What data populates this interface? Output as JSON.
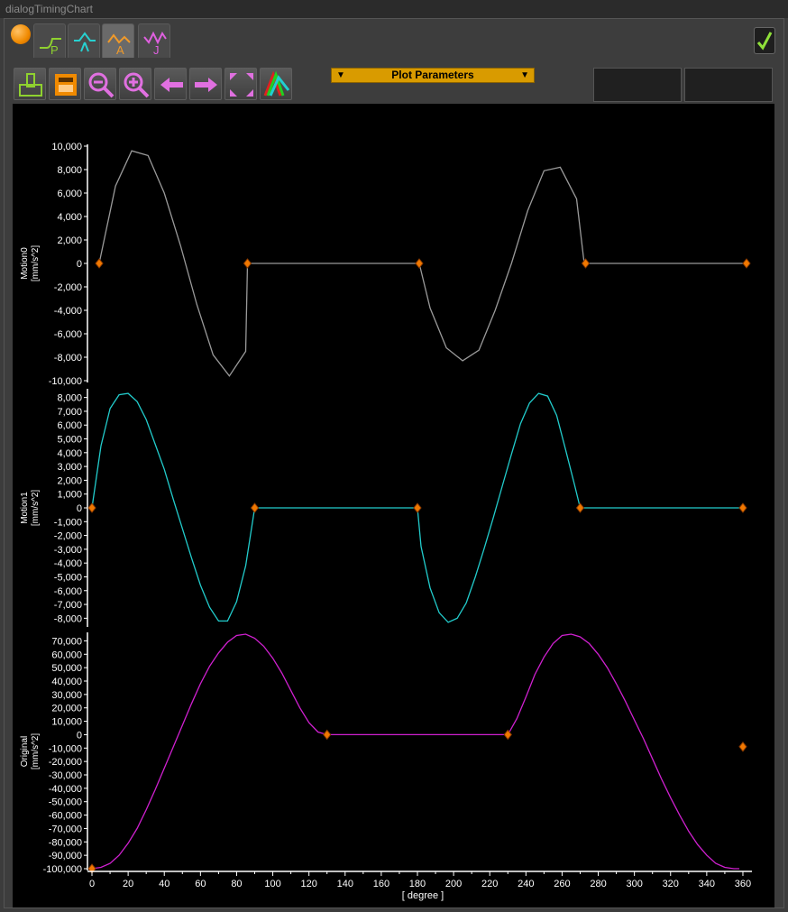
{
  "window": {
    "title": "dialogTimingChart"
  },
  "tabs": [
    {
      "name": "position",
      "letter": "P",
      "color": "#8fd12f"
    },
    {
      "name": "velocity",
      "letter": "",
      "color": "#27d0d0"
    },
    {
      "name": "acceleration",
      "letter": "A",
      "color": "#f09a2a",
      "active": true
    },
    {
      "name": "jerk",
      "letter": "J",
      "color": "#e060e0"
    }
  ],
  "toolbar": {
    "buttons": [
      "export-icon",
      "save-icon",
      "zoom-out-icon",
      "zoom-in-icon",
      "arrow-left-icon",
      "arrow-right-icon",
      "fit-icon",
      "curves-icon"
    ],
    "plot_parameters_label": "Plot Parameters"
  },
  "colors": {
    "accent": "#d99b00",
    "marker": "#f07800",
    "motion0": "#9a9a9a",
    "motion1": "#22cccc",
    "original": "#d020d0"
  },
  "chart_data": [
    {
      "type": "line",
      "ylabel": "Motion0\n[mm/s^2]",
      "ylim": [
        -10000,
        10000
      ],
      "yticks": [
        10000,
        8000,
        6000,
        4000,
        2000,
        0,
        -2000,
        -4000,
        -6000,
        -8000,
        -10000
      ],
      "ytick_labels": [
        "10,000",
        "8,000",
        "6,000",
        "4,000",
        "2,000",
        "0",
        "-2,000",
        "-4,000",
        "-6,000",
        "-8,000",
        "-10,000"
      ],
      "series": [
        {
          "x": [
            4,
            13,
            22,
            31,
            40,
            49,
            58,
            67,
            76,
            85,
            86,
            91,
            160,
            181,
            187,
            196,
            205,
            214,
            223,
            232,
            241,
            250,
            259,
            268,
            272,
            273,
            280,
            300,
            320,
            358,
            362
          ],
          "y": [
            0,
            6600,
            9600,
            9200,
            6000,
            1500,
            -3500,
            -7800,
            -9600,
            -7500,
            0,
            0,
            0,
            0,
            -3800,
            -7200,
            -8300,
            -7400,
            -4000,
            0,
            4500,
            7900,
            8200,
            5500,
            300,
            0,
            0,
            0,
            0,
            0,
            0
          ]
        }
      ],
      "markers_x": [
        4,
        86,
        181,
        273,
        362
      ],
      "markers_y": [
        0,
        0,
        0,
        0,
        0
      ]
    },
    {
      "type": "line",
      "ylabel": "Motion1\n[mm/s^2]",
      "ylim": [
        -8500,
        8500
      ],
      "yticks": [
        8000,
        7000,
        6000,
        5000,
        4000,
        3000,
        2000,
        1000,
        0,
        -1000,
        -2000,
        -3000,
        -4000,
        -5000,
        -6000,
        -7000,
        -8000
      ],
      "ytick_labels": [
        "8,000",
        "7,000",
        "6,000",
        "5,000",
        "4,000",
        "3,000",
        "2,000",
        "1,000",
        "0",
        "-1,000",
        "-2,000",
        "-3,000",
        "-4,000",
        "-5,000",
        "-6,000",
        "-7,000",
        "-8,000"
      ],
      "series": [
        {
          "x": [
            0,
            5,
            10,
            15,
            20,
            25,
            30,
            35,
            40,
            45,
            50,
            55,
            60,
            65,
            70,
            75,
            80,
            85,
            90,
            100,
            120,
            140,
            160,
            180,
            182,
            187,
            192,
            197,
            202,
            207,
            212,
            217,
            222,
            227,
            232,
            237,
            242,
            247,
            252,
            257,
            262,
            267,
            270,
            300,
            330,
            360
          ],
          "y": [
            0,
            4500,
            7200,
            8200,
            8300,
            7700,
            6400,
            4600,
            2800,
            600,
            -1500,
            -3600,
            -5600,
            -7200,
            -8200,
            -8200,
            -6800,
            -4200,
            0,
            0,
            0,
            0,
            0,
            0,
            -2800,
            -5800,
            -7600,
            -8300,
            -8000,
            -6900,
            -5000,
            -2900,
            -700,
            1600,
            3900,
            6100,
            7600,
            8300,
            8100,
            6700,
            4200,
            1600,
            0,
            0,
            0,
            0
          ]
        }
      ],
      "markers_x": [
        0,
        90,
        180,
        270,
        360
      ],
      "markers_y": [
        0,
        0,
        0,
        0,
        0
      ]
    },
    {
      "type": "line",
      "ylabel": "Original\n[mm/s^2]",
      "xlabel": "[ degree ]",
      "ylim": [
        -100000,
        75000
      ],
      "yticks": [
        70000,
        60000,
        50000,
        40000,
        30000,
        20000,
        10000,
        0,
        -10000,
        -20000,
        -30000,
        -40000,
        -50000,
        -60000,
        -70000,
        -80000,
        -90000,
        -100000
      ],
      "ytick_labels": [
        "70,000",
        "60,000",
        "50,000",
        "40,000",
        "30,000",
        "20,000",
        "10,000",
        "0",
        "-10,000",
        "-20,000",
        "-30,000",
        "-40,000",
        "-50,000",
        "-60,000",
        "-70,000",
        "-80,000",
        "-90,000",
        "-100,000"
      ],
      "xlim": [
        -2,
        365
      ],
      "xticks": [
        0,
        20,
        40,
        60,
        80,
        100,
        120,
        140,
        160,
        180,
        200,
        220,
        240,
        260,
        280,
        300,
        320,
        340,
        360
      ],
      "series": [
        {
          "x": [
            0,
            5,
            10,
            15,
            20,
            25,
            30,
            35,
            40,
            45,
            50,
            55,
            60,
            65,
            70,
            75,
            80,
            85,
            90,
            95,
            100,
            105,
            110,
            115,
            120,
            125,
            130,
            230,
            235,
            240,
            245,
            250,
            255,
            260,
            265,
            270,
            275,
            280,
            285,
            290,
            295,
            300,
            305,
            310,
            315,
            320,
            325,
            330,
            335,
            340,
            345,
            350,
            355,
            358
          ],
          "y": [
            -100000,
            -99000,
            -96000,
            -90000,
            -81000,
            -70000,
            -56000,
            -41000,
            -25000,
            -9000,
            7000,
            23000,
            38000,
            51000,
            61000,
            69000,
            74000,
            75000,
            72000,
            66000,
            57000,
            46000,
            33000,
            20000,
            9000,
            2000,
            0,
            0,
            12000,
            28000,
            45000,
            58000,
            68000,
            74000,
            75000,
            73000,
            68000,
            60000,
            50000,
            38000,
            25000,
            11000,
            -3000,
            -18000,
            -33000,
            -47000,
            -60000,
            -72000,
            -82000,
            -90000,
            -96000,
            -99000,
            -100000,
            -100000
          ]
        }
      ],
      "markers_x": [
        0,
        130,
        230,
        360
      ],
      "markers_y": [
        -100000,
        0,
        0,
        -9000
      ]
    }
  ]
}
